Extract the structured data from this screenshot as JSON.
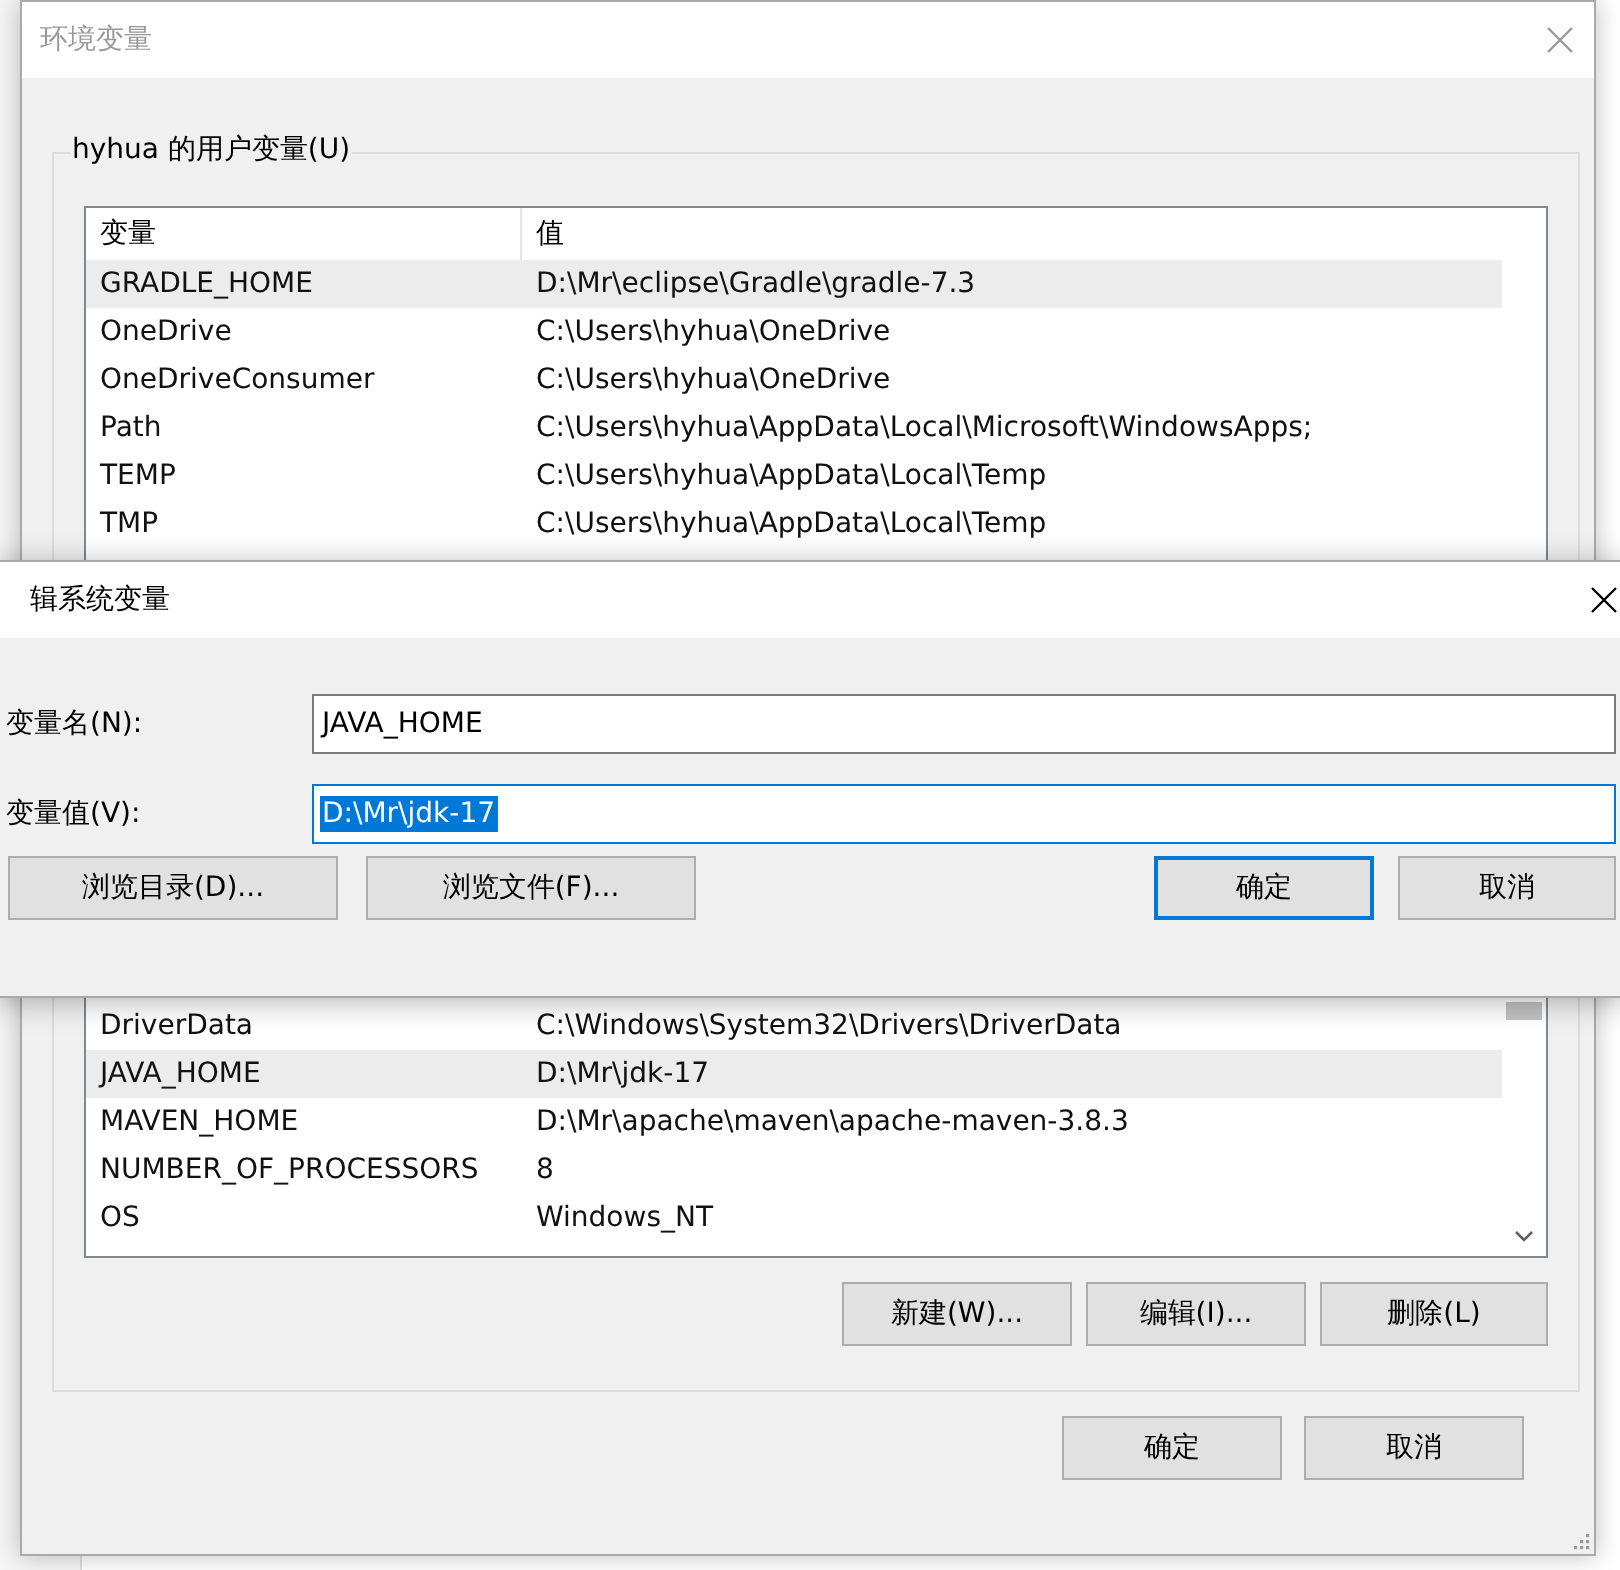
{
  "env_dialog": {
    "title": "环境变量",
    "user_group": {
      "label": "hyhua 的用户变量(U)",
      "columns": [
        "变量",
        "值"
      ],
      "rows": [
        {
          "name": "GRADLE_HOME",
          "value": "D:\\Mr\\eclipse\\Gradle\\gradle-7.3",
          "selected": true
        },
        {
          "name": "OneDrive",
          "value": "C:\\Users\\hyhua\\OneDrive",
          "selected": false
        },
        {
          "name": "OneDriveConsumer",
          "value": "C:\\Users\\hyhua\\OneDrive",
          "selected": false
        },
        {
          "name": "Path",
          "value": "C:\\Users\\hyhua\\AppData\\Local\\Microsoft\\WindowsApps;",
          "selected": false
        },
        {
          "name": "TEMP",
          "value": "C:\\Users\\hyhua\\AppData\\Local\\Temp",
          "selected": false
        },
        {
          "name": "TMP",
          "value": "C:\\Users\\hyhua\\AppData\\Local\\Temp",
          "selected": false
        }
      ]
    },
    "system_group": {
      "rows": [
        {
          "name": "DriverData",
          "value": "C:\\Windows\\System32\\Drivers\\DriverData",
          "selected": false
        },
        {
          "name": "JAVA_HOME",
          "value": "D:\\Mr\\jdk-17",
          "selected": true
        },
        {
          "name": "MAVEN_HOME",
          "value": "D:\\Mr\\apache\\maven\\apache-maven-3.8.3",
          "selected": false
        },
        {
          "name": "NUMBER_OF_PROCESSORS",
          "value": "8",
          "selected": false
        },
        {
          "name": "OS",
          "value": "Windows_NT",
          "selected": false
        }
      ],
      "buttons": [
        "新建(W)...",
        "编辑(I)...",
        "删除(L)"
      ]
    },
    "buttons": [
      "确定",
      "取消"
    ]
  },
  "edit_dialog": {
    "title": "辑系统变量",
    "fields": [
      {
        "label": "变量名(N):",
        "value": "JAVA_HOME",
        "text_selected": false
      },
      {
        "label": "变量值(V):",
        "value": "D:\\Mr\\jdk-17",
        "text_selected": true
      }
    ],
    "left_buttons": [
      "浏览目录(D)...",
      "浏览文件(F)..."
    ],
    "right_buttons": [
      {
        "label": "确定",
        "focused": true
      },
      {
        "label": "取消",
        "focused": false
      }
    ]
  }
}
